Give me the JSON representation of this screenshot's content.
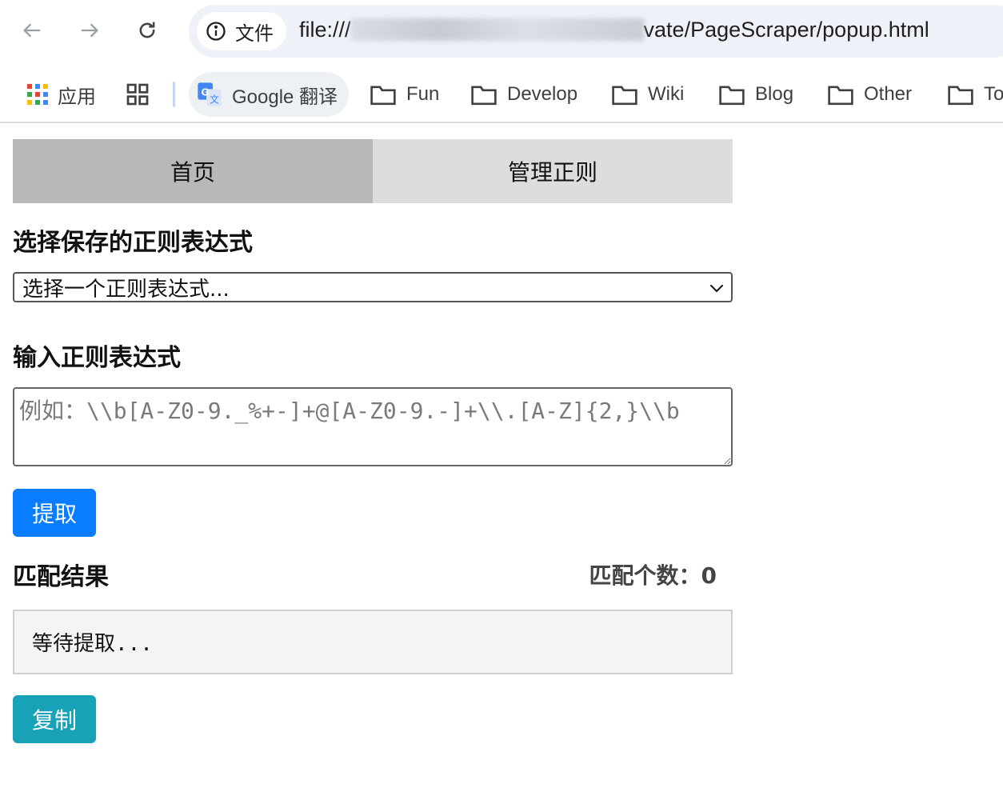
{
  "browser": {
    "site_chip_label": "文件",
    "url_prefix": "file:///",
    "url_suffix": "vate/PageScraper/popup.html"
  },
  "bookmarks": {
    "apps_label": "应用",
    "translate_label": "Google 翻译",
    "folders": [
      "Fun",
      "Develop",
      "Wiki",
      "Blog",
      "Other",
      "To"
    ]
  },
  "tabs": [
    {
      "label": "首页",
      "active": true
    },
    {
      "label": "管理正则",
      "active": false
    }
  ],
  "saved_regex": {
    "title": "选择保存的正则表达式",
    "selected": "选择一个正则表达式..."
  },
  "input_regex": {
    "title": "输入正则表达式",
    "placeholder": "例如：\\\\b[A-Z0-9._%+-]+@[A-Z0-9.-]+\\\\.[A-Z]{2,}\\\\b"
  },
  "extract_button": "提取",
  "results": {
    "title": "匹配结果",
    "count_label": "匹配个数：",
    "count": "0",
    "status": "等待提取..."
  },
  "copy_button": "复制",
  "colors": {
    "primary": "#0a7cff",
    "info": "#17a2b8",
    "tab_active": "#b8b8b8",
    "tab_inactive": "#dddddd"
  }
}
